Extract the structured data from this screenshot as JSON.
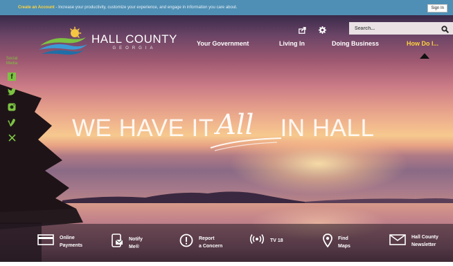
{
  "topbar": {
    "link_text": "Create an Account",
    "message": " - Increase your productivity, customize your experience, and engage in information you care about.",
    "signin_label": "Sign In"
  },
  "logo": {
    "name": "HALL COUNTY",
    "sub": "GEORGIA"
  },
  "search": {
    "placeholder": "Search..."
  },
  "nav": {
    "items": [
      {
        "label": "Your Government"
      },
      {
        "label": "Living In"
      },
      {
        "label": "Doing Business"
      },
      {
        "label": "How Do I..."
      }
    ]
  },
  "social": {
    "label_line1": "Social",
    "label_line2": "Media"
  },
  "hero": {
    "tagline_left": "WE HAVE IT",
    "tagline_all": "All",
    "tagline_right": "IN HALL"
  },
  "quicklinks": [
    {
      "line1": "Online",
      "line2": "Payments",
      "icon": "card-icon"
    },
    {
      "line1": "Notify",
      "line2": "Me®",
      "icon": "notify-icon"
    },
    {
      "line1": "Report",
      "line2": "a Concern",
      "icon": "alert-icon"
    },
    {
      "line1": "TV 18",
      "line2": "",
      "icon": "broadcast-icon"
    },
    {
      "line1": "Find",
      "line2": "Maps",
      "icon": "map-pin-icon"
    },
    {
      "line1": "Hall County",
      "line2": "Newsletter",
      "icon": "envelope-icon"
    }
  ],
  "colors": {
    "accent_yellow": "#ffd23f",
    "topbar_blue": "#4f8fb5",
    "social_green": "#7dc242"
  }
}
